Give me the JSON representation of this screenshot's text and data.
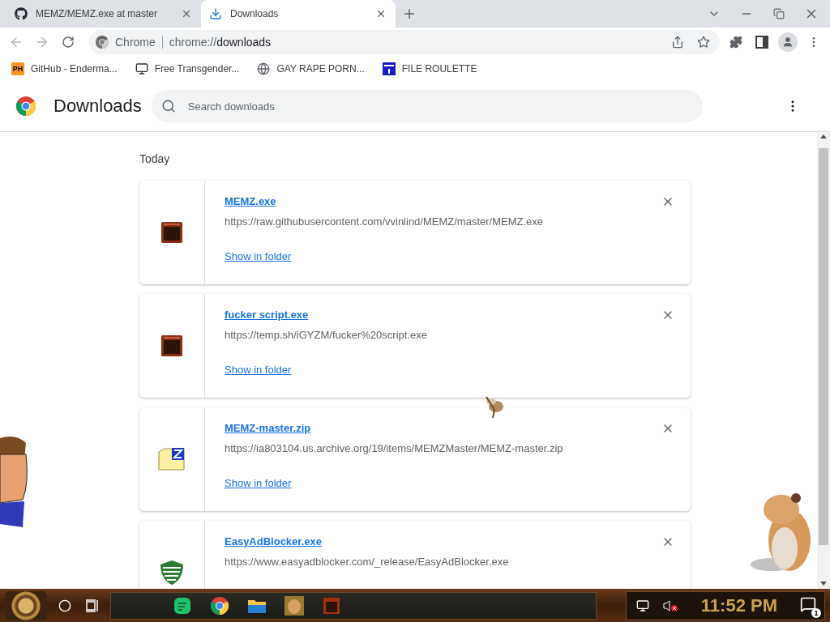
{
  "window": {
    "tabs": [
      {
        "title": "MEMZ/MEMZ.exe at master",
        "kind": "github",
        "selected": false
      },
      {
        "title": "Downloads",
        "kind": "download",
        "selected": true
      }
    ]
  },
  "address_bar": {
    "site_label": "Chrome",
    "url_scheme": "chrome://",
    "url_host": "downloads"
  },
  "bookmarks": [
    {
      "label": "GitHub - Enderma...",
      "kind": "badge",
      "badge": "PH"
    },
    {
      "label": "Free Transgender...",
      "kind": "computer"
    },
    {
      "label": "GAY RAPE PORN...",
      "kind": "globe"
    },
    {
      "label": "FILE ROULETTE",
      "kind": "blue"
    }
  ],
  "header": {
    "title": "Downloads",
    "search": {
      "placeholder": "Search downloads"
    }
  },
  "section": "Today",
  "downloads": [
    {
      "name": "MEMZ.exe",
      "url": "https://raw.githubusercontent.com/vvinlind/MEMZ/master/MEMZ.exe",
      "kind": "app",
      "action": "Show in folder"
    },
    {
      "name": "fucker script.exe",
      "url": "https://temp.sh/iGYZM/fucker%20script.exe",
      "kind": "app",
      "action": "Show in folder"
    },
    {
      "name": "MEMZ-master.zip",
      "url": "https://ia803104.us.archive.org/19/items/MEMZMaster/MEMZ-master.zip",
      "kind": "archive",
      "action": "Show in folder"
    },
    {
      "name": "EasyAdBlocker.exe",
      "url": "https://www.easyadblocker.com/_release/EasyAdBlocker.exe",
      "kind": "shield"
    }
  ],
  "taskbar": {
    "clock": "11:52 PM",
    "notifications": "1"
  }
}
